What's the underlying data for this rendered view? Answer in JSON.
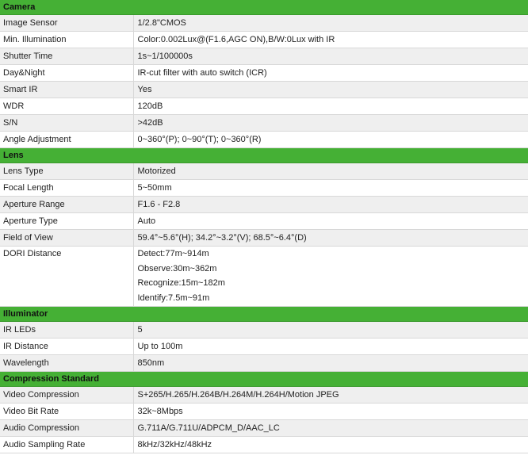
{
  "sections": [
    {
      "title": "Camera",
      "rows": [
        {
          "label": "Image Sensor",
          "values": [
            "1/2.8\"CMOS"
          ]
        },
        {
          "label": "Min. Illumination",
          "values": [
            "Color:0.002Lux@(F1.6,AGC ON),B/W:0Lux with IR"
          ]
        },
        {
          "label": "Shutter Time",
          "values": [
            "1s~1/100000s"
          ]
        },
        {
          "label": "Day&Night",
          "values": [
            "IR-cut filter with auto switch (ICR)"
          ]
        },
        {
          "label": "Smart IR",
          "values": [
            "Yes"
          ]
        },
        {
          "label": "WDR",
          "values": [
            "120dB"
          ]
        },
        {
          "label": "S/N",
          "values": [
            ">42dB"
          ]
        },
        {
          "label": "Angle Adjustment",
          "values": [
            "0~360°(P); 0~90°(T); 0~360°(R)"
          ]
        }
      ]
    },
    {
      "title": "Lens",
      "rows": [
        {
          "label": "Lens Type",
          "values": [
            "Motorized"
          ]
        },
        {
          "label": "Focal Length",
          "values": [
            "5~50mm"
          ]
        },
        {
          "label": "Aperture Range",
          "values": [
            "F1.6 - F2.8"
          ]
        },
        {
          "label": "Aperture Type",
          "values": [
            "Auto"
          ]
        },
        {
          "label": "Field of View",
          "values": [
            "59.4°~5.6°(H); 34.2°~3.2°(V); 68.5°~6.4°(D)"
          ]
        },
        {
          "label": "DORI Distance",
          "values": [
            "Detect:77m~914m",
            "Observe:30m~362m",
            "Recognize:15m~182m",
            "Identify:7.5m~91m"
          ]
        }
      ]
    },
    {
      "title": "Illuminator",
      "rows": [
        {
          "label": "IR LEDs",
          "values": [
            "5"
          ]
        },
        {
          "label": "IR Distance",
          "values": [
            "Up to 100m"
          ]
        },
        {
          "label": "Wavelength",
          "values": [
            "850nm"
          ]
        }
      ]
    },
    {
      "title": "Compression Standard",
      "rows": [
        {
          "label": "Video Compression",
          "values": [
            "S+265/H.265/H.264B/H.264M/H.264H/Motion JPEG"
          ]
        },
        {
          "label": "Video Bit Rate",
          "values": [
            "32k~8Mbps"
          ]
        },
        {
          "label": "Audio Compression",
          "values": [
            "G.711A/G.711U/ADPCM_D/AAC_LC"
          ]
        },
        {
          "label": "Audio Sampling Rate",
          "values": [
            "8kHz/32kHz/48kHz"
          ]
        }
      ]
    }
  ]
}
